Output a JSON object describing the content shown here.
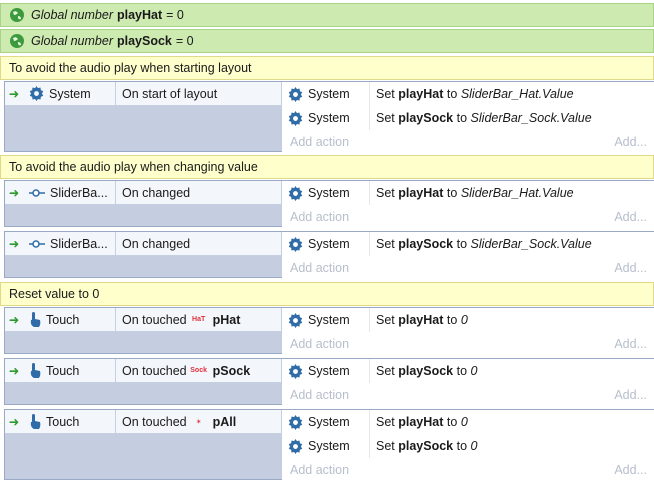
{
  "globals": [
    {
      "prefix": "Global number",
      "name": "playHat",
      "value": "= 0"
    },
    {
      "prefix": "Global number",
      "name": "playSock",
      "value": "= 0"
    }
  ],
  "comments": [
    "To avoid the audio play when starting layout",
    "To avoid the audio play when changing value",
    "Reset value to 0"
  ],
  "labels": {
    "system": "System",
    "add_action": "Add action",
    "add": "Add...",
    "set": "Set",
    "to": "to"
  },
  "events": [
    {
      "object": "System",
      "condition": "On start of layout",
      "target": "",
      "actions": [
        {
          "variable": "playHat",
          "value": "SliderBar_Hat.Value"
        },
        {
          "variable": "playSock",
          "value": "SliderBar_Sock.Value"
        }
      ]
    },
    {
      "object": "SliderBa...",
      "condition": "On changed",
      "target": "",
      "actions": [
        {
          "variable": "playHat",
          "value": "SliderBar_Hat.Value"
        }
      ]
    },
    {
      "object": "SliderBa...",
      "condition": "On changed",
      "target": "",
      "actions": [
        {
          "variable": "playSock",
          "value": "SliderBar_Sock.Value"
        }
      ]
    },
    {
      "object": "Touch",
      "condition": "On touched",
      "target": "pHat",
      "sprite": "HaT",
      "actions": [
        {
          "variable": "playHat",
          "value": "0"
        }
      ]
    },
    {
      "object": "Touch",
      "condition": "On touched",
      "target": "pSock",
      "sprite": "Sock",
      "actions": [
        {
          "variable": "playSock",
          "value": "0"
        }
      ]
    },
    {
      "object": "Touch",
      "condition": "On touched",
      "target": "pAll",
      "sprite": "✶",
      "actions": [
        {
          "variable": "playHat",
          "value": "0"
        },
        {
          "variable": "playSock",
          "value": "0"
        }
      ]
    }
  ]
}
